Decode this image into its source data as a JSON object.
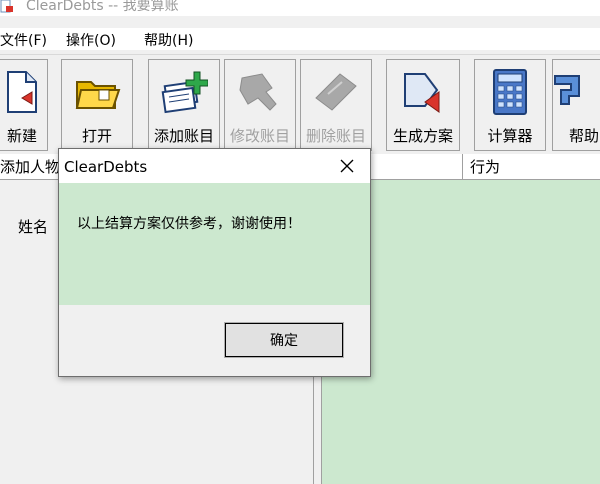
{
  "window": {
    "title": "ClearDebts -- 我要算账"
  },
  "menu": {
    "items": [
      "文件(F)",
      "操作(O)",
      "帮助(H)"
    ]
  },
  "toolbar": {
    "buttons": [
      {
        "label": "新建",
        "icon": "new-document-icon",
        "enabled": true
      },
      {
        "label": "打开",
        "icon": "open-folder-icon",
        "enabled": true
      },
      {
        "label": "添加账目",
        "icon": "add-entry-icon",
        "enabled": true
      },
      {
        "label": "修改账目",
        "icon": "edit-entry-icon",
        "enabled": false
      },
      {
        "label": "删除账目",
        "icon": "delete-entry-icon",
        "enabled": false
      },
      {
        "label": "生成方案",
        "icon": "generate-plan-icon",
        "enabled": true
      },
      {
        "label": "计算器",
        "icon": "calculator-icon",
        "enabled": true
      },
      {
        "label": "帮助",
        "icon": "help-icon",
        "enabled": true
      }
    ]
  },
  "left_panel": {
    "header": "添加人物",
    "name_label": "姓名"
  },
  "right_panel": {
    "header": "行为"
  },
  "dialog": {
    "title": "ClearDebts",
    "message": "以上结算方案仅供参考，谢谢使用！",
    "ok_label": "确定"
  },
  "colors": {
    "body_green": "#cce8cf",
    "window_bg": "#f0f0f0",
    "accent_red": "#d9342b"
  }
}
